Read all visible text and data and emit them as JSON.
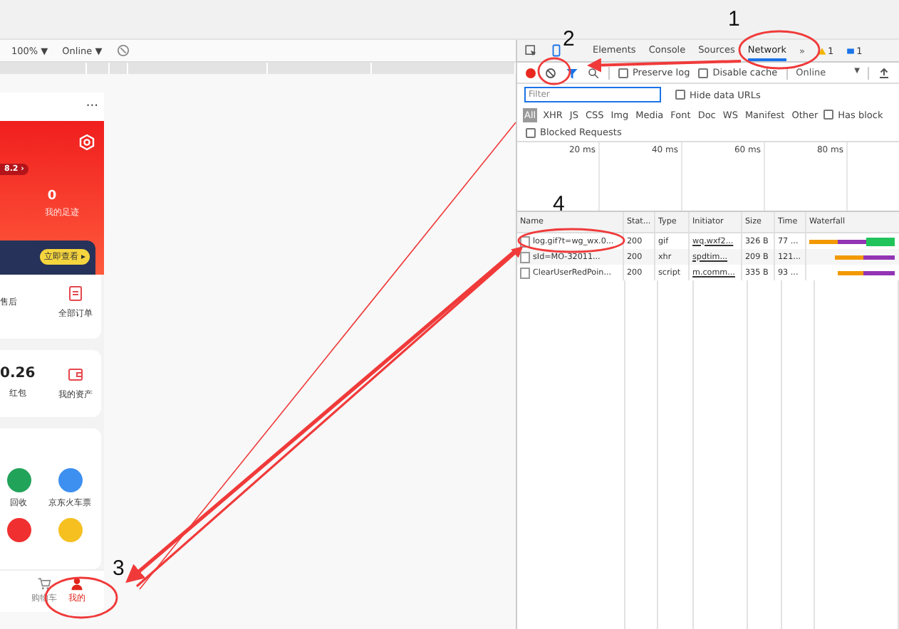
{
  "viewport_bar": {
    "zoom": "100% ▼",
    "network": "Online ▼"
  },
  "phone": {
    "more": "···",
    "badge": "8.2 ›",
    "count": "0",
    "count_label": "我的足迹",
    "view_button": "立即查看 ▸",
    "orders": [
      {
        "label": "售后"
      },
      {
        "label": "全部订单"
      }
    ],
    "assets": {
      "value": "0.26",
      "label": "红包",
      "wallet_label": "我的资产"
    },
    "services": [
      {
        "label": "回收",
        "color": "#22a35a"
      },
      {
        "label": "京东火车票",
        "color": "#3d8ff0"
      },
      {
        "color": "#f03030"
      },
      {
        "color": "#f5c020"
      }
    ],
    "tabbar": [
      {
        "label": "购物车",
        "selected": false
      },
      {
        "label": "我的",
        "selected": true
      }
    ]
  },
  "devtools": {
    "tabs": [
      {
        "label": "Elements",
        "selected": false
      },
      {
        "label": "Console",
        "selected": false
      },
      {
        "label": "Sources",
        "selected": false
      },
      {
        "label": "Network",
        "selected": true
      }
    ],
    "more": "»",
    "warnings": "1",
    "messages": "1",
    "toolbar": {
      "recording": true,
      "checks": [
        {
          "label": "Preserve log",
          "checked": false
        },
        {
          "label": "Disable cache",
          "checked": false
        }
      ],
      "throttle": "Online",
      "throttle_caret": "▼"
    },
    "filter": {
      "placeholder": "Filter"
    },
    "hide_data_urls": {
      "label": "Hide data URLs",
      "checked": false
    },
    "types": [
      {
        "label": "All",
        "selected": true
      },
      {
        "label": "XHR",
        "selected": false
      },
      {
        "label": "JS",
        "selected": false
      },
      {
        "label": "CSS",
        "selected": false
      },
      {
        "label": "Img",
        "selected": false
      },
      {
        "label": "Media",
        "selected": false
      },
      {
        "label": "Font",
        "selected": false
      },
      {
        "label": "Doc",
        "selected": false
      },
      {
        "label": "WS",
        "selected": false
      },
      {
        "label": "Manifest",
        "selected": false
      },
      {
        "label": "Other",
        "selected": false
      }
    ],
    "has_blocked": {
      "label": "Has block",
      "checked": false
    },
    "blocked_requests": {
      "label": "Blocked Requests",
      "checked": false
    },
    "overview_ticks": [
      "20 ms",
      "40 ms",
      "60 ms",
      "80 ms"
    ],
    "columns": [
      "Name",
      "Stat...",
      "Type",
      "Initiator",
      "Size",
      "Time",
      "Waterfall"
    ],
    "rows": [
      {
        "name": "log.gif?t=wg_wx.0...",
        "status": "200",
        "type": "gif",
        "initiator": "wq.wxf2...",
        "size": "326 B",
        "time": "77 ..."
      },
      {
        "name": "sId=MO-32011...",
        "status": "200",
        "type": "xhr",
        "initiator": "spdtim...",
        "size": "209 B",
        "time": "121..."
      },
      {
        "name": "ClearUserRedPoin...",
        "status": "200",
        "type": "script",
        "initiator": "m.comm...",
        "size": "335 B",
        "time": "93 ..."
      }
    ]
  },
  "annotations": [
    {
      "label": "1"
    },
    {
      "label": "2"
    },
    {
      "label": "3"
    },
    {
      "label": "4"
    }
  ]
}
